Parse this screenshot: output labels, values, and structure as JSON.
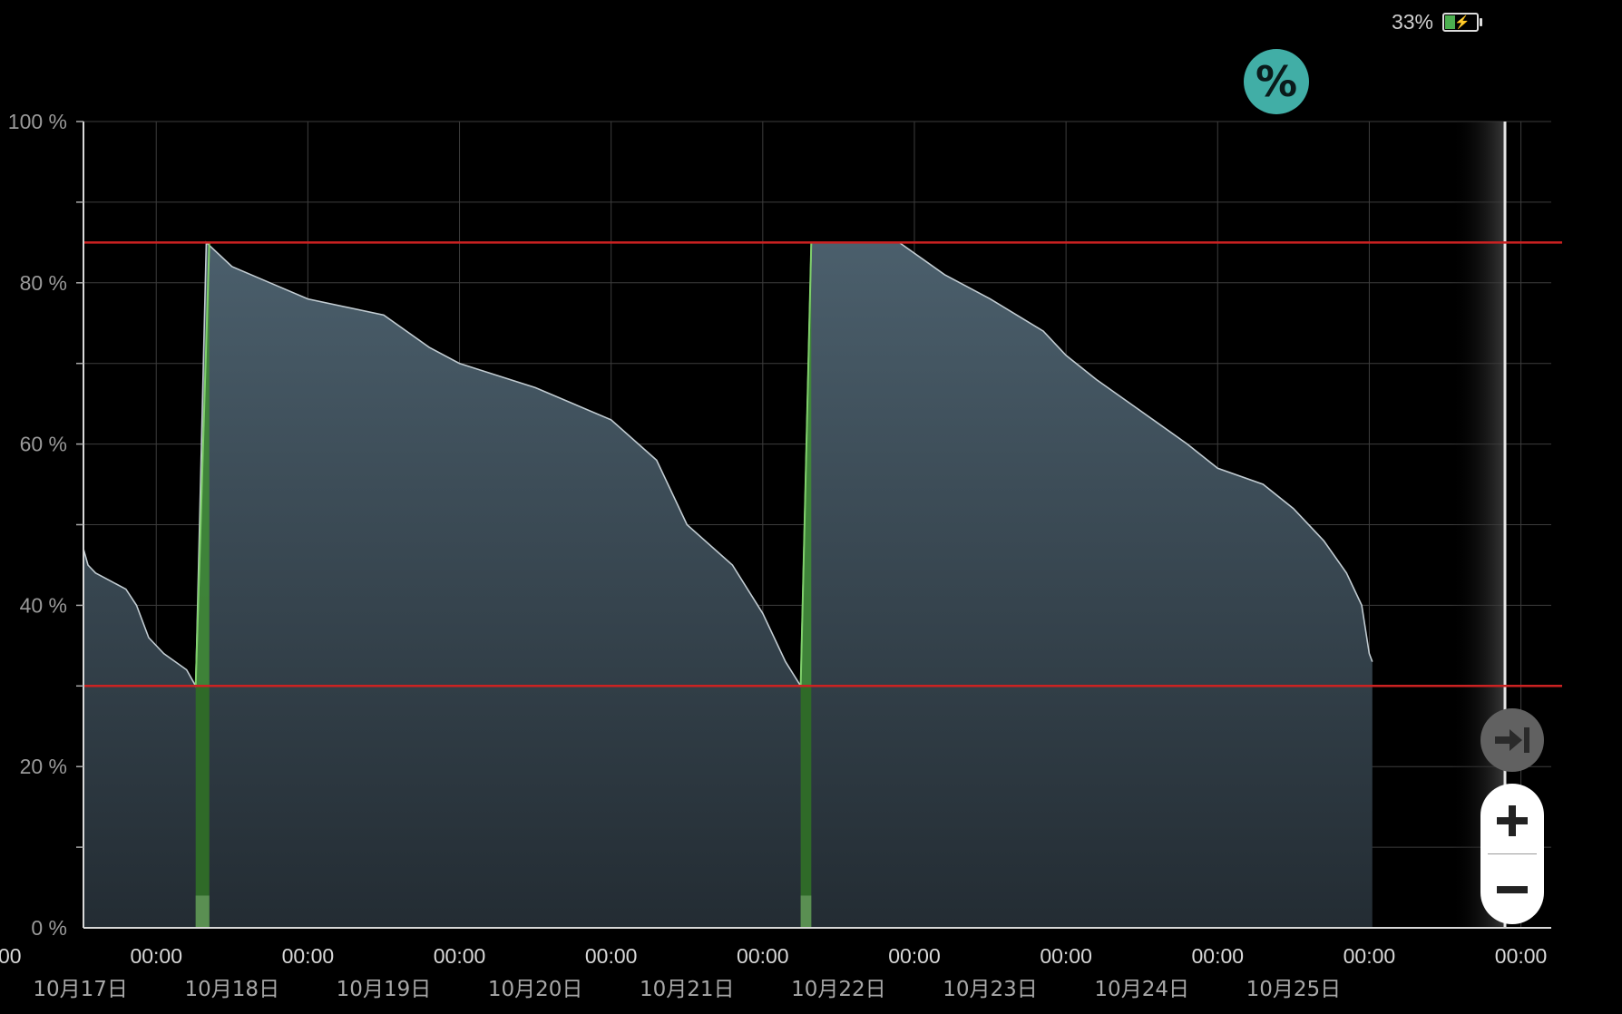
{
  "status_bar": {
    "battery_percent": "33%",
    "battery_icon": "battery-charging-icon",
    "battery_level": 0.33
  },
  "buttons": {
    "percent_label": "%",
    "jump_to_end_icon": "jump-to-end-icon",
    "zoom_in_icon": "plus-icon",
    "zoom_out_icon": "minus-icon"
  },
  "colors": {
    "background": "#000000",
    "area_top": "#4b5f6c",
    "area_bottom": "#232c33",
    "line": "#c2ccd2",
    "charge": "#3f8a36",
    "charge_line": "#7fcf6a",
    "threshold": "#cc2222",
    "grid": "#3d3d3d",
    "accent": "#41aea6"
  },
  "chart_data": {
    "type": "area",
    "title": "",
    "xlabel": "",
    "ylabel": "",
    "ylim": [
      0,
      100
    ],
    "y_ticks": [
      "0 %",
      "20 %",
      "40 %",
      "60 %",
      "80 %",
      "100 %"
    ],
    "x_tick_time_label": "00:00",
    "x_partial_left_label": "00",
    "x_date_labels": [
      "10月17日",
      "10月18日",
      "10月19日",
      "10月20日",
      "10月21日",
      "10月22日",
      "10月23日",
      "10月24日",
      "10月25日"
    ],
    "xlim_days": [
      16.52,
      26.2
    ],
    "thresholds": [
      85,
      30
    ],
    "charging_periods": [
      [
        17.26,
        17.35
      ],
      [
        21.25,
        21.32
      ]
    ],
    "series": [
      {
        "values": [
          [
            16.52,
            47
          ],
          [
            16.55,
            45
          ],
          [
            16.6,
            44
          ],
          [
            16.7,
            43
          ],
          [
            16.8,
            42
          ],
          [
            16.87,
            40
          ],
          [
            16.95,
            36
          ],
          [
            17.05,
            34
          ],
          [
            17.2,
            32
          ],
          [
            17.26,
            30
          ],
          [
            17.33,
            85
          ],
          [
            17.5,
            82
          ],
          [
            17.75,
            80
          ],
          [
            18.0,
            78
          ],
          [
            18.5,
            76
          ],
          [
            18.8,
            72
          ],
          [
            19.0,
            70
          ],
          [
            19.5,
            67
          ],
          [
            20.0,
            63
          ],
          [
            20.3,
            58
          ],
          [
            20.5,
            50
          ],
          [
            20.8,
            45
          ],
          [
            21.0,
            39
          ],
          [
            21.15,
            33
          ],
          [
            21.25,
            30
          ],
          [
            21.32,
            85
          ],
          [
            21.9,
            85
          ],
          [
            22.2,
            81
          ],
          [
            22.5,
            78
          ],
          [
            22.85,
            74
          ],
          [
            23.0,
            71
          ],
          [
            23.2,
            68
          ],
          [
            23.5,
            64
          ],
          [
            23.8,
            60
          ],
          [
            24.0,
            57
          ],
          [
            24.3,
            55
          ],
          [
            24.5,
            52
          ],
          [
            24.7,
            48
          ],
          [
            24.85,
            44
          ],
          [
            24.95,
            40
          ],
          [
            25.0,
            34
          ],
          [
            25.02,
            33
          ]
        ]
      }
    ]
  }
}
